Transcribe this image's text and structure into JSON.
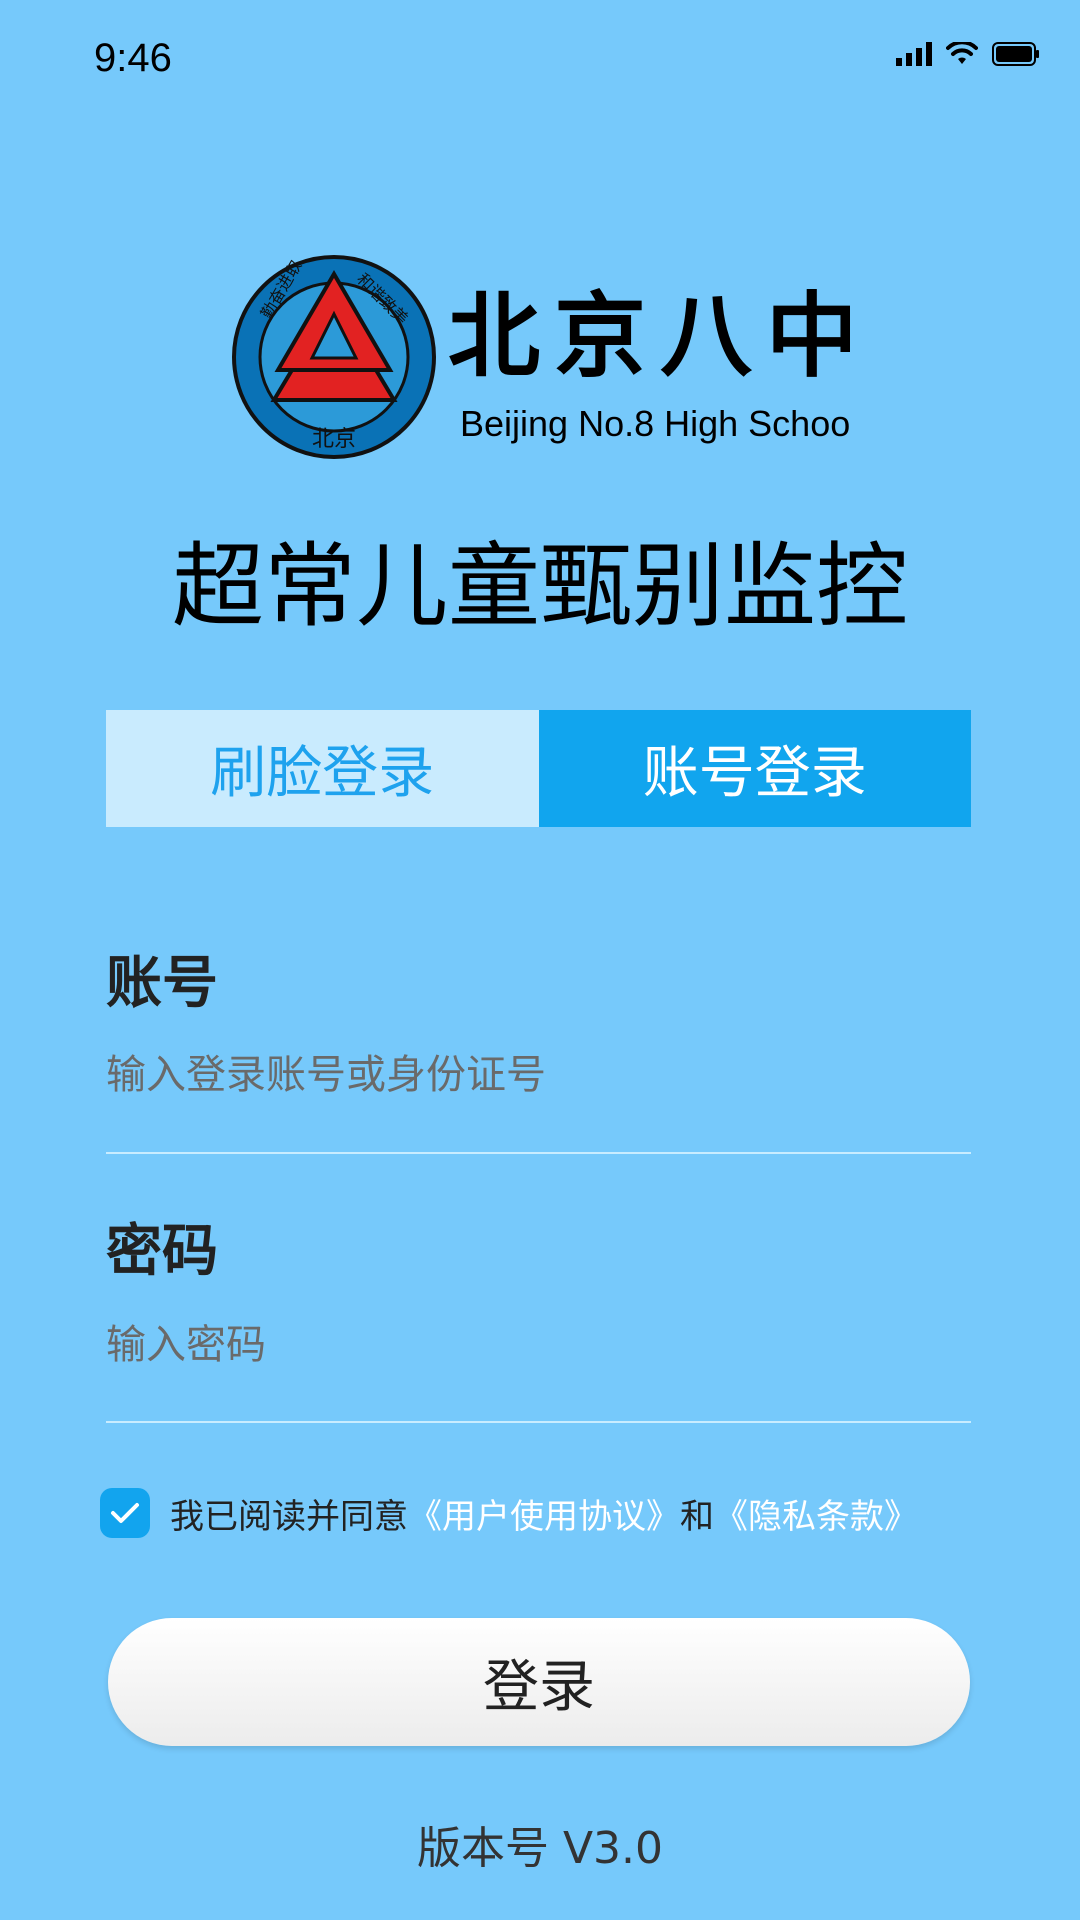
{
  "status_bar": {
    "time": "9:46",
    "icons": [
      "signal-icon",
      "wifi-icon",
      "battery-icon"
    ]
  },
  "logo": {
    "school_name": "北京八中",
    "school_name_en": "Beijing No.8 High School",
    "emblem_text": [
      "勤奋进取",
      "和谐致美",
      "北京"
    ]
  },
  "app_title": "超常儿童甄别监控",
  "tabs": [
    {
      "label": "刷脸登录",
      "active": false
    },
    {
      "label": "账号登录",
      "active": true
    }
  ],
  "form": {
    "account_label": "账号",
    "account_placeholder": "输入登录账号或身份证号",
    "account_value": "",
    "password_label": "密码",
    "password_placeholder": "输入密码",
    "password_value": ""
  },
  "agreement": {
    "checked": true,
    "prefix": "我已阅读并同意",
    "user_agreement": "《用户使用协议》",
    "conjunction": "和",
    "privacy_policy": "《隐私条款》"
  },
  "login_button": "登录",
  "version": "版本号 V3.0",
  "colors": {
    "background": "#76c9fb",
    "tab_active": "#11a5ee",
    "tab_inactive": "#c9ebfe",
    "accent_blue": "#1ea2ee",
    "checkbox": "#12a4ee"
  }
}
